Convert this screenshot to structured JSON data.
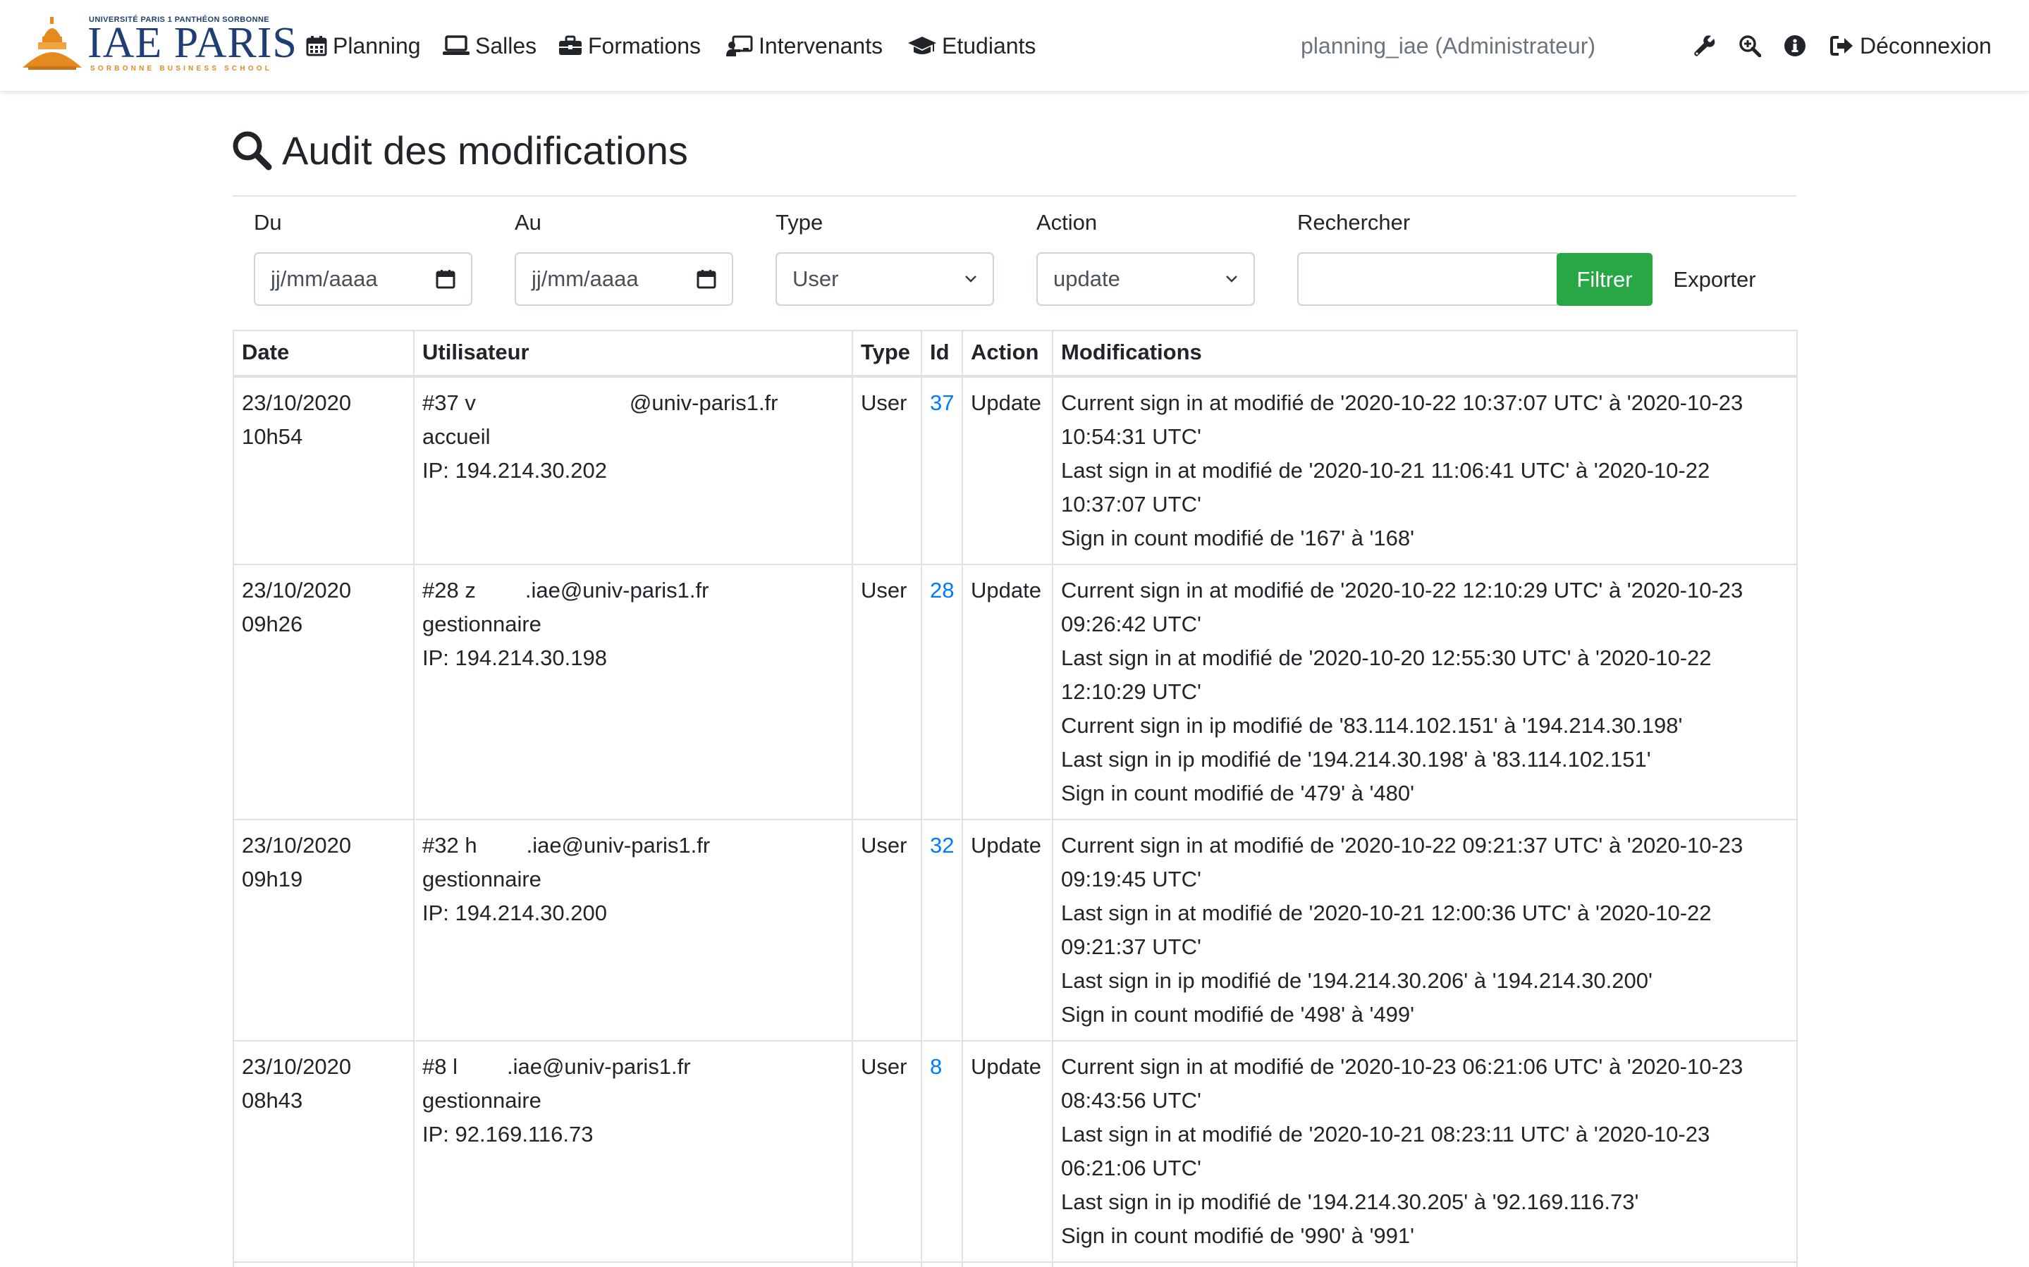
{
  "brand": {
    "university": "UNIVERSITÉ PARIS 1 PANTHÉON SORBONNE",
    "name": "IAE PARIS",
    "tagline": "SORBONNE BUSINESS SCHOOL",
    "blue": "#1f3f74",
    "orange": "#e58a1f"
  },
  "nav": {
    "items": [
      {
        "label": "Planning",
        "icon": "calendar-icon"
      },
      {
        "label": "Salles",
        "icon": "laptop-icon"
      },
      {
        "label": "Formations",
        "icon": "briefcase-icon"
      },
      {
        "label": "Intervenants",
        "icon": "chalkboard-teacher-icon"
      },
      {
        "label": "Etudiants",
        "icon": "graduation-cap-icon"
      }
    ],
    "user": "planning_iae (Administrateur)",
    "tools": [
      "wrench-icon",
      "search-plus-icon",
      "info-circle-icon"
    ],
    "logout": {
      "label": "Déconnexion",
      "icon": "sign-out-icon"
    }
  },
  "page": {
    "title": "Audit des modifications",
    "title_icon": "search-icon"
  },
  "filters": {
    "from": {
      "label": "Du",
      "placeholder": "jj/mm/aaaa"
    },
    "to": {
      "label": "Au",
      "placeholder": "jj/mm/aaaa"
    },
    "type": {
      "label": "Type",
      "value": "User"
    },
    "action": {
      "label": "Action",
      "value": "update"
    },
    "search": {
      "label": "Rechercher",
      "value": ""
    },
    "filter_button": "Filtrer",
    "export_link": "Exporter",
    "button_color": "#28a745"
  },
  "table": {
    "headers": [
      "Date",
      "Utilisateur",
      "Type",
      "Id",
      "Action",
      "Modifications"
    ],
    "rows": [
      {
        "date": "23/10/2020",
        "time": "10h54",
        "user_prefix": "#37 v",
        "user_email": "@univ-paris1.fr",
        "role": "accueil",
        "ip": "IP: 194.214.30.202",
        "type": "User",
        "id": "37",
        "action": "Update",
        "modifications": [
          "Current sign in at modifié de '2020-10-22 10:37:07 UTC' à '2020-10-23 10:54:31 UTC'",
          "Last sign in at modifié de '2020-10-21 11:06:41 UTC' à '2020-10-22 10:37:07 UTC'",
          "Sign in count modifié de '167' à '168'"
        ]
      },
      {
        "date": "23/10/2020",
        "time": "09h26",
        "user_prefix": "#28 z",
        "user_email": ".iae@univ-paris1.fr",
        "role": "gestionnaire",
        "ip": "IP: 194.214.30.198",
        "type": "User",
        "id": "28",
        "action": "Update",
        "modifications": [
          "Current sign in at modifié de '2020-10-22 12:10:29 UTC' à '2020-10-23 09:26:42 UTC'",
          "Last sign in at modifié de '2020-10-20 12:55:30 UTC' à '2020-10-22 12:10:29 UTC'",
          "Current sign in ip modifié de '83.114.102.151' à '194.214.30.198'",
          "Last sign in ip modifié de '194.214.30.198' à '83.114.102.151'",
          "Sign in count modifié de '479' à '480'"
        ]
      },
      {
        "date": "23/10/2020",
        "time": "09h19",
        "user_prefix": "#32 h",
        "user_email": ".iae@univ-paris1.fr",
        "role": "gestionnaire",
        "ip": "IP: 194.214.30.200",
        "type": "User",
        "id": "32",
        "action": "Update",
        "modifications": [
          "Current sign in at modifié de '2020-10-22 09:21:37 UTC' à '2020-10-23 09:19:45 UTC'",
          "Last sign in at modifié de '2020-10-21 12:00:36 UTC' à '2020-10-22 09:21:37 UTC'",
          "Last sign in ip modifié de '194.214.30.206' à '194.214.30.200'",
          "Sign in count modifié de '498' à '499'"
        ]
      },
      {
        "date": "23/10/2020",
        "time": "08h43",
        "user_prefix": "#8 l",
        "user_email": ".iae@univ-paris1.fr",
        "role": "gestionnaire",
        "ip": "IP: 92.169.116.73",
        "type": "User",
        "id": "8",
        "action": "Update",
        "modifications": [
          "Current sign in at modifié de '2020-10-23 06:21:06 UTC' à '2020-10-23 08:43:56 UTC'",
          "Last sign in at modifié de '2020-10-21 08:23:11 UTC' à '2020-10-23 06:21:06 UTC'",
          "Last sign in ip modifié de '194.214.30.205' à '92.169.116.73'",
          "Sign in count modifié de '990' à '991'"
        ]
      }
    ]
  }
}
